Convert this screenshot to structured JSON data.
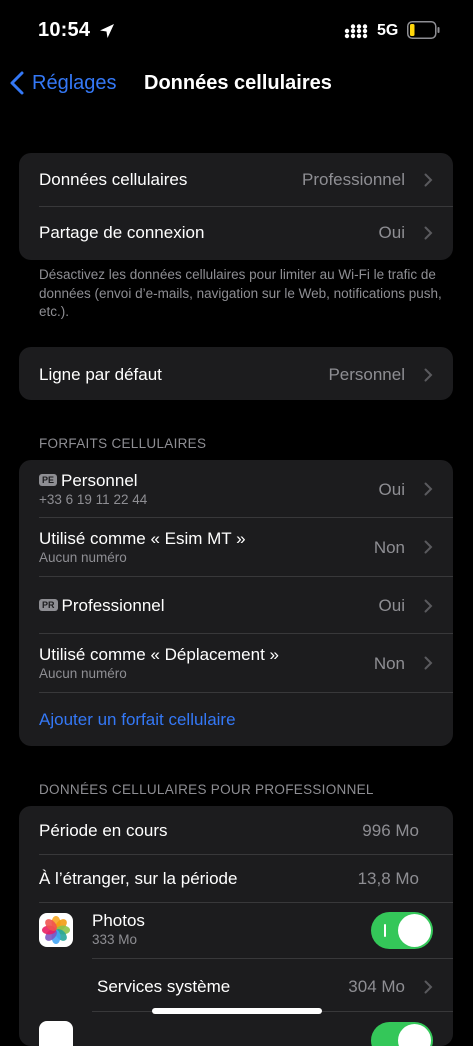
{
  "status_bar": {
    "time": "10:54",
    "network": "5G",
    "battery_color": "#ffd60a"
  },
  "nav": {
    "back_label": "Réglages",
    "title": "Données cellulaires"
  },
  "group1": {
    "rows": [
      {
        "label": "Données cellulaires",
        "value": "Professionnel"
      },
      {
        "label": "Partage de connexion",
        "value": "Oui"
      }
    ],
    "footer": "Désactivez les données cellulaires pour limiter au Wi-Fi le trafic de données (envoi d’e-mails, navigation sur le Web, notifications push, etc.)."
  },
  "group2": {
    "rows": [
      {
        "label": "Ligne par défaut",
        "value": "Personnel"
      }
    ]
  },
  "plans": {
    "header": "FORFAITS CELLULAIRES",
    "rows": [
      {
        "badge": "PE",
        "label": "Personnel",
        "sub": "+33 6 19 11 22 44",
        "value": "Oui"
      },
      {
        "label": "Utilisé comme « Esim MT »",
        "sub": "Aucun numéro",
        "value": "Non"
      },
      {
        "badge": "PR",
        "label": "Professionnel",
        "value": "Oui"
      },
      {
        "label": "Utilisé comme « Déplacement »",
        "sub": "Aucun numéro",
        "value": "Non"
      }
    ],
    "add_link": "Ajouter un forfait cellulaire"
  },
  "usage": {
    "header": "DONNÉES CELLULAIRES POUR PROFESSIONNEL",
    "rows": [
      {
        "label": "Période en cours",
        "value": "996 Mo"
      },
      {
        "label": "À l’étranger, sur la période",
        "value": "13,8 Mo"
      }
    ],
    "apps": [
      {
        "icon": "photos-icon",
        "name": "Photos",
        "size": "333 Mo",
        "enabled": true
      }
    ],
    "system_services": {
      "label": "Services système",
      "value": "304 Mo"
    },
    "accent_color": "#34c759"
  }
}
